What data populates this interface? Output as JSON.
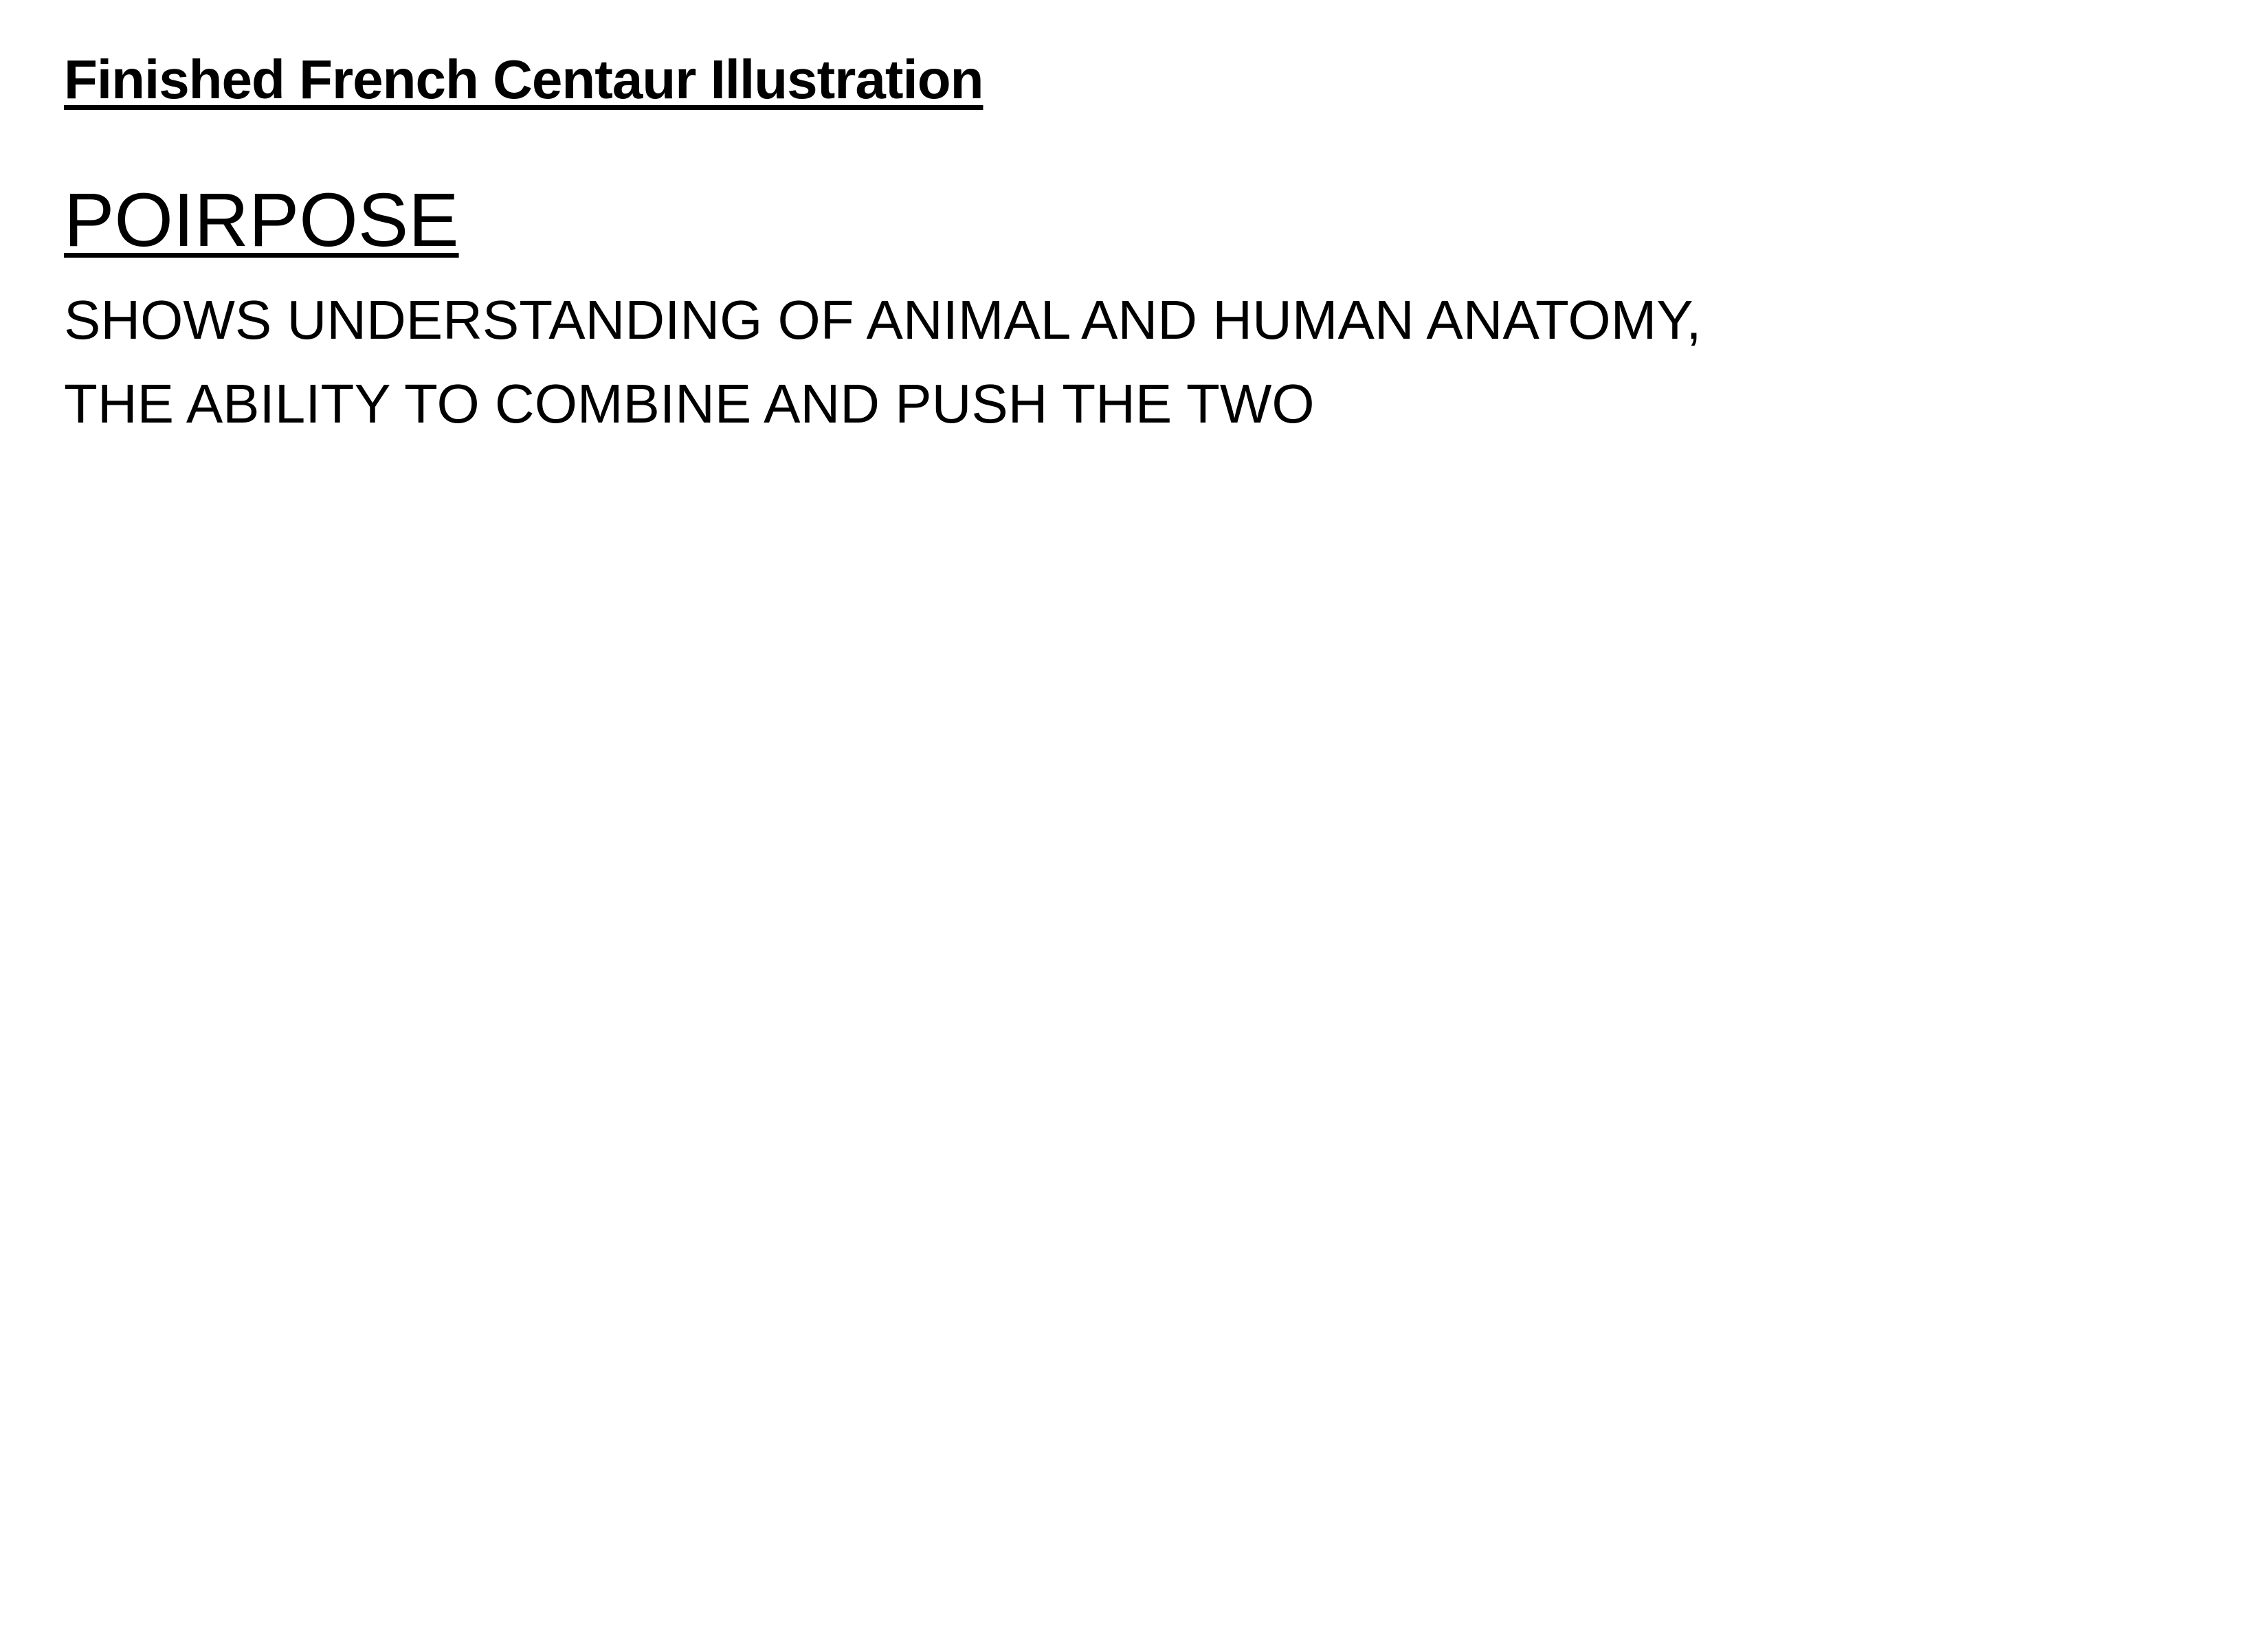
{
  "document": {
    "title": "Finished French Centaur Illustration",
    "section_heading": "POIRPOSE",
    "body_lines": [
      "SHOWS UNDERSTANDING OF ANIMAL AND HUMAN ANATOMY,",
      "THE ABILITY TO COMBINE AND PUSH THE TWO"
    ]
  },
  "colors": {
    "background": "#ffffff",
    "text": "#000000"
  }
}
